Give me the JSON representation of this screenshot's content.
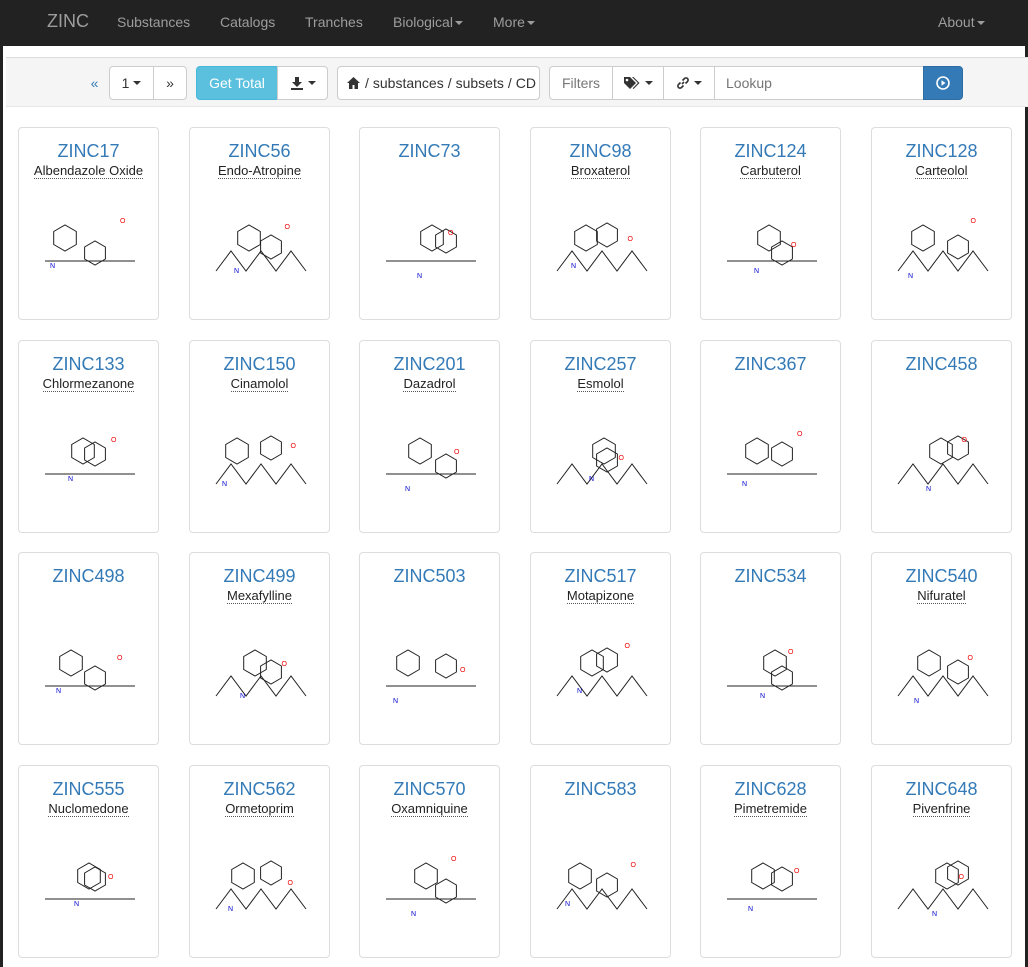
{
  "navbar": {
    "brand": "ZINC",
    "items": [
      {
        "label": "Substances"
      },
      {
        "label": "Catalogs"
      },
      {
        "label": "Tranches"
      },
      {
        "label": "Biological",
        "dropdown": true
      },
      {
        "label": "More",
        "dropdown": true
      }
    ],
    "right": {
      "label": "About",
      "dropdown": true
    }
  },
  "toolbar": {
    "prev": "«",
    "page": "1",
    "next": "»",
    "get_total": "Get Total",
    "breadcrumb": [
      "substances",
      "subsets",
      "CD"
    ],
    "filters": "Filters",
    "lookup_placeholder": "Lookup"
  },
  "substances": [
    {
      "id": "ZINC17",
      "name": "Albendazole Oxide"
    },
    {
      "id": "ZINC56",
      "name": "Endo-Atropine"
    },
    {
      "id": "ZINC73",
      "name": ""
    },
    {
      "id": "ZINC98",
      "name": "Broxaterol"
    },
    {
      "id": "ZINC124",
      "name": "Carbuterol"
    },
    {
      "id": "ZINC128",
      "name": "Carteolol"
    },
    {
      "id": "ZINC133",
      "name": "Chlormezanone"
    },
    {
      "id": "ZINC150",
      "name": "Cinamolol"
    },
    {
      "id": "ZINC201",
      "name": "Dazadrol"
    },
    {
      "id": "ZINC257",
      "name": "Esmolol"
    },
    {
      "id": "ZINC367",
      "name": ""
    },
    {
      "id": "ZINC458",
      "name": ""
    },
    {
      "id": "ZINC498",
      "name": ""
    },
    {
      "id": "ZINC499",
      "name": "Mexafylline"
    },
    {
      "id": "ZINC503",
      "name": ""
    },
    {
      "id": "ZINC517",
      "name": "Motapizone"
    },
    {
      "id": "ZINC534",
      "name": ""
    },
    {
      "id": "ZINC540",
      "name": "Nifuratel"
    },
    {
      "id": "ZINC555",
      "name": "Nuclomedone"
    },
    {
      "id": "ZINC562",
      "name": "Ormetoprim"
    },
    {
      "id": "ZINC570",
      "name": "Oxamniquine"
    },
    {
      "id": "ZINC583",
      "name": ""
    },
    {
      "id": "ZINC628",
      "name": "Pimetremide"
    },
    {
      "id": "ZINC648",
      "name": "Pivenfrine"
    }
  ]
}
